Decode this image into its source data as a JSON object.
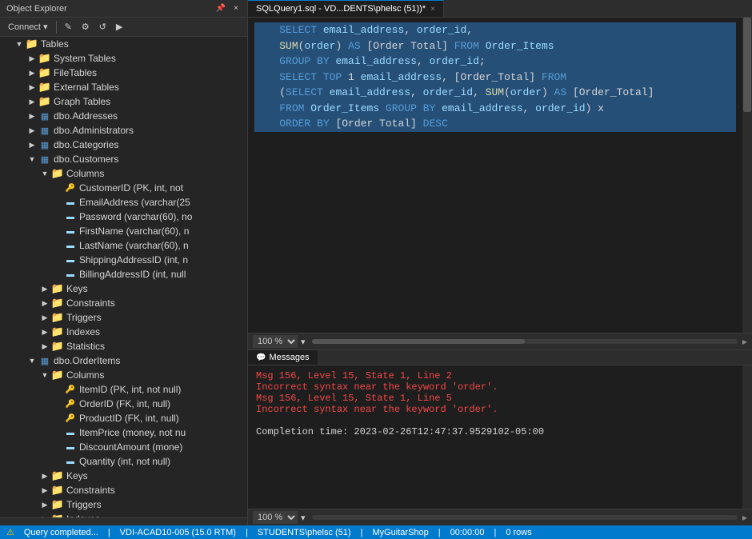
{
  "object_explorer": {
    "title": "Object Explorer",
    "controls": [
      "–",
      "□",
      "×"
    ],
    "toolbar": {
      "connect_label": "Connect ▾",
      "buttons": [
        "🔌",
        "✕",
        "⚙",
        "🔄",
        "▶"
      ]
    },
    "tree": [
      {
        "id": "tables",
        "label": "Tables",
        "level": 1,
        "expanded": true,
        "icon": "folder"
      },
      {
        "id": "system_tables",
        "label": "System Tables",
        "level": 2,
        "expanded": false,
        "icon": "folder"
      },
      {
        "id": "file_tables",
        "label": "FileTables",
        "level": 2,
        "expanded": false,
        "icon": "folder"
      },
      {
        "id": "external_tables",
        "label": "External Tables",
        "level": 2,
        "expanded": false,
        "icon": "folder"
      },
      {
        "id": "graph_tables",
        "label": "Graph Tables",
        "level": 2,
        "expanded": false,
        "icon": "folder"
      },
      {
        "id": "addresses",
        "label": "dbo.Addresses",
        "level": 2,
        "expanded": false,
        "icon": "table"
      },
      {
        "id": "administrators",
        "label": "dbo.Administrators",
        "level": 2,
        "expanded": false,
        "icon": "table"
      },
      {
        "id": "categories",
        "label": "dbo.Categories",
        "level": 2,
        "expanded": false,
        "icon": "table"
      },
      {
        "id": "customers",
        "label": "dbo.Customers",
        "level": 2,
        "expanded": true,
        "icon": "table"
      },
      {
        "id": "columns",
        "label": "Columns",
        "level": 3,
        "expanded": true,
        "icon": "folder"
      },
      {
        "id": "customer_id",
        "label": "CustomerID (PK, int, not",
        "level": 4,
        "icon": "key"
      },
      {
        "id": "email_address",
        "label": "EmailAddress (varchar(25",
        "level": 4,
        "icon": "column"
      },
      {
        "id": "password",
        "label": "Password (varchar(60), no",
        "level": 4,
        "icon": "column"
      },
      {
        "id": "firstname",
        "label": "FirstName (varchar(60), n",
        "level": 4,
        "icon": "column"
      },
      {
        "id": "lastname",
        "label": "LastName (varchar(60), n",
        "level": 4,
        "icon": "column"
      },
      {
        "id": "shipping_addr",
        "label": "ShippingAddressID (int, n",
        "level": 4,
        "icon": "column"
      },
      {
        "id": "billing_addr",
        "label": "BillingAddressID (int, null",
        "level": 4,
        "icon": "column"
      },
      {
        "id": "keys",
        "label": "Keys",
        "level": 3,
        "expanded": false,
        "icon": "folder"
      },
      {
        "id": "constraints",
        "label": "Constraints",
        "level": 3,
        "expanded": false,
        "icon": "folder"
      },
      {
        "id": "triggers",
        "label": "Triggers",
        "level": 3,
        "expanded": false,
        "icon": "folder"
      },
      {
        "id": "indexes",
        "label": "Indexes",
        "level": 3,
        "expanded": false,
        "icon": "folder"
      },
      {
        "id": "statistics",
        "label": "Statistics",
        "level": 3,
        "expanded": false,
        "icon": "folder"
      },
      {
        "id": "orderitems",
        "label": "dbo.OrderItems",
        "level": 2,
        "expanded": true,
        "icon": "table"
      },
      {
        "id": "columns2",
        "label": "Columns",
        "level": 3,
        "expanded": true,
        "icon": "folder"
      },
      {
        "id": "item_id",
        "label": "ItemID (PK, int, not null)",
        "level": 4,
        "icon": "key"
      },
      {
        "id": "order_id",
        "label": "OrderID (FK, int, null)",
        "level": 4,
        "icon": "key"
      },
      {
        "id": "product_id",
        "label": "ProductID (FK, int, null)",
        "level": 4,
        "icon": "key"
      },
      {
        "id": "item_price",
        "label": "ItemPrice (money, not nu",
        "level": 4,
        "icon": "column"
      },
      {
        "id": "discount_amount",
        "label": "DiscountAmount (mone)",
        "level": 4,
        "icon": "column"
      },
      {
        "id": "quantity",
        "label": "Quantity (int, not null)",
        "level": 4,
        "icon": "column"
      },
      {
        "id": "keys2",
        "label": "Keys",
        "level": 3,
        "expanded": false,
        "icon": "folder"
      },
      {
        "id": "constraints2",
        "label": "Constraints",
        "level": 3,
        "expanded": false,
        "icon": "folder"
      },
      {
        "id": "triggers2",
        "label": "Triggers",
        "level": 3,
        "expanded": false,
        "icon": "folder"
      },
      {
        "id": "indexes2",
        "label": "Indexes",
        "level": 3,
        "expanded": false,
        "icon": "folder"
      }
    ]
  },
  "editor": {
    "tab_label": "SQLQuery1.sql - VD...DENTS\\phelsc (51))*",
    "tab_close": "×",
    "zoom": "100 %",
    "code_lines": [
      {
        "text": "    SELECT email_address, order_id,",
        "selected": true
      },
      {
        "text": "    SUM(order) AS [Order Total] FROM Order_Items",
        "selected": true
      },
      {
        "text": "    GROUP BY email_address, order_id;",
        "selected": true
      },
      {
        "text": "    SELECT TOP 1 email_address, [Order_Total] FROM",
        "selected": true
      },
      {
        "text": "    (SELECT email_address, order_id, SUM(order) AS [Order_Total]",
        "selected": true
      },
      {
        "text": "    FROM Order_Items GROUP BY email_address, order_id) x",
        "selected": true
      },
      {
        "text": "    ORDER BY [Order Total] DESC",
        "selected": true
      }
    ]
  },
  "messages": {
    "tab_label": "Messages",
    "tab_icon": "💬",
    "zoom": "100 %",
    "lines": [
      {
        "text": "Msg 156, Level 15, State 1, Line 2",
        "type": "error"
      },
      {
        "text": "Incorrect syntax near the keyword 'order'.",
        "type": "error"
      },
      {
        "text": "Msg 156, Level 15, State 1, Line 5",
        "type": "error"
      },
      {
        "text": "Incorrect syntax near the keyword 'order'.",
        "type": "error"
      },
      {
        "text": "",
        "type": "info"
      },
      {
        "text": "Completion time: 2023-02-26T12:47:37.9529102-05:00",
        "type": "info"
      }
    ]
  },
  "status_bar": {
    "warning_icon": "⚠",
    "query_status": "Query completed...",
    "server": "VDI-ACAD10-005 (15.0 RTM)",
    "login": "STUDENTS\\phelsc (51)",
    "database": "MyGuitarShop",
    "time": "00:00:00",
    "rows": "0 rows"
  }
}
